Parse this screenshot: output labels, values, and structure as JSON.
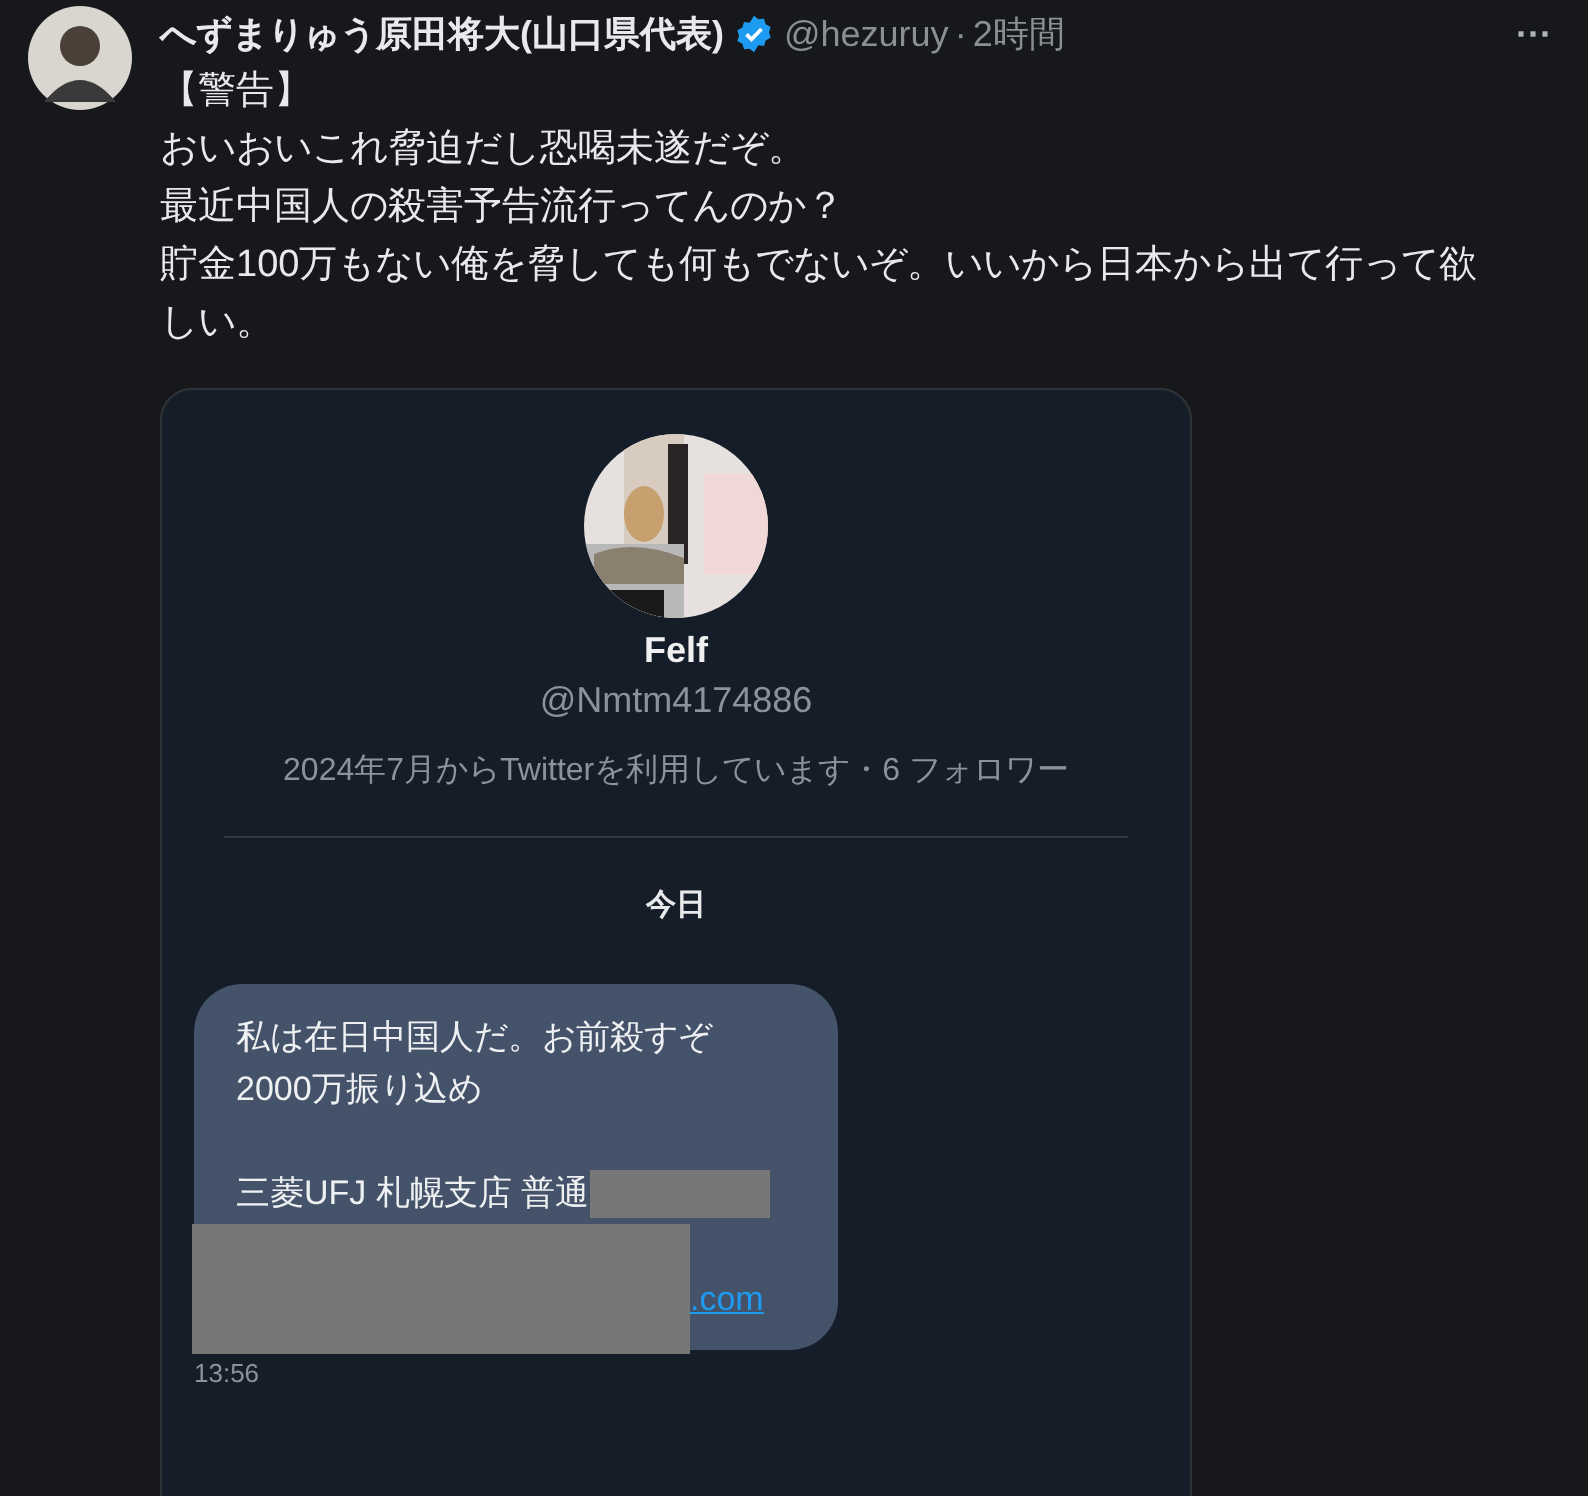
{
  "post": {
    "author": "へずまりゅう原田将大(山口県代表)",
    "verified": true,
    "handle": "@hezuruy",
    "separator": "·",
    "time": "2時間",
    "more": "···",
    "lines": [
      "【警告】",
      "おいおいこれ脅迫だし恐喝未遂だぞ。",
      "最近中国人の殺害予告流行ってんのか？",
      "貯金100万もない俺を脅しても何もでないぞ。いいから日本から出て行って欲しい。"
    ]
  },
  "attachment": {
    "profile": {
      "name": "Felf",
      "handle": "@Nmtm4174886",
      "info": "2024年7月からTwitterを利用しています・6 フォロワー"
    },
    "date_divider": "今日",
    "message": {
      "lines": [
        {
          "kind": "text",
          "text": "私は在日中国人だ。お前殺すぞ",
          "redacted": false
        },
        {
          "kind": "text",
          "text": "2000万振り込め",
          "redacted": false
        },
        {
          "kind": "blank"
        },
        {
          "kind": "text",
          "text": "三菱UFJ 札幌支店 普通",
          "redacted": true
        },
        {
          "kind": "link",
          "text": ".com",
          "redacted": true
        }
      ],
      "time": "13:56"
    }
  }
}
